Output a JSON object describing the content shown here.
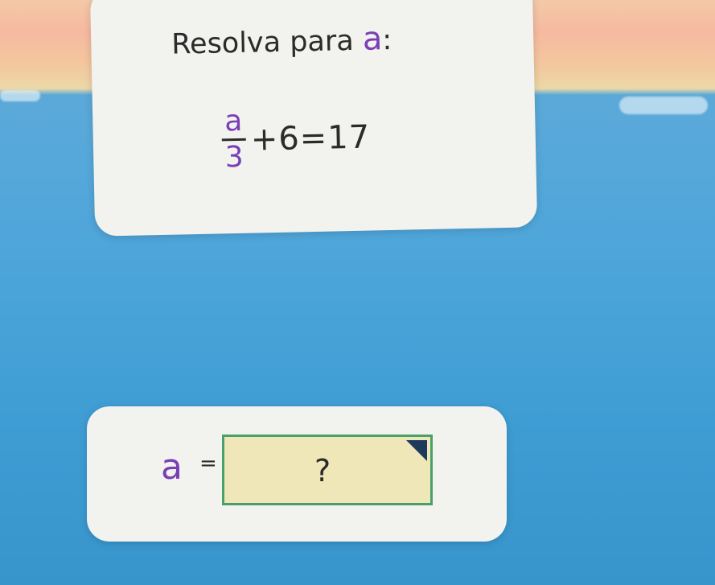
{
  "question": {
    "prompt": "Resolva para",
    "variable": "a",
    "colon": ":",
    "equation": {
      "numerator": "a",
      "denominator": "3",
      "rest": "+6=17"
    }
  },
  "answer": {
    "variable": "a",
    "equals": "=",
    "placeholder": "?"
  },
  "colors": {
    "variable": "#7b3fb5",
    "answer_box_bg": "#efe7b7",
    "answer_box_border": "#4aa06b",
    "card": "#f2f2ef"
  }
}
